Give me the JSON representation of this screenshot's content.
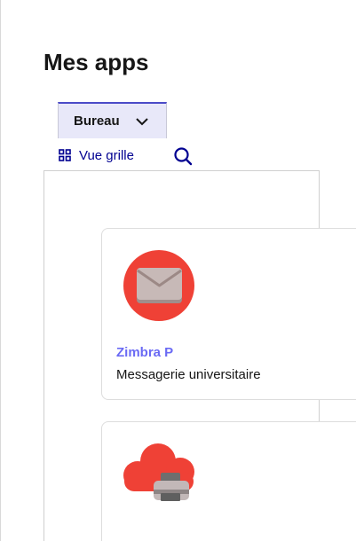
{
  "page": {
    "title": "Mes apps"
  },
  "tabs": {
    "active_label": "Bureau"
  },
  "toolbar": {
    "view_label": "Vue grille"
  },
  "icons": {
    "tab_chevron": "chevron-down-icon",
    "view": "grid-icon",
    "search": "search-icon",
    "app_1": "mail-icon",
    "app_2": "cloud-printer-icon"
  },
  "apps": [
    {
      "name": "Zimbra P",
      "description": "Messagerie universitaire"
    },
    {
      "name": "",
      "description": ""
    }
  ],
  "colors": {
    "accent": "#000091",
    "tab_bg": "#e8e8f9",
    "app_name": "#6a6af4",
    "app_icon_red": "#ef4136"
  }
}
